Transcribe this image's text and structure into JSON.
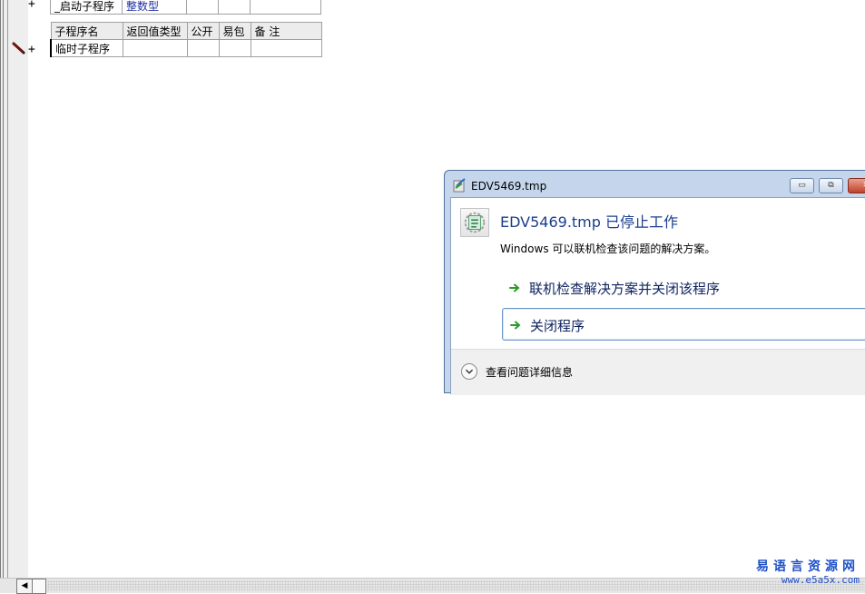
{
  "code_table_1": {
    "row": [
      "_启动子程序",
      "整数型",
      "",
      "",
      ""
    ]
  },
  "code_table_2": {
    "headers": [
      "子程序名",
      "返回值类型",
      "公开",
      "易包",
      "备 注"
    ],
    "row": [
      "临时子程序",
      "",
      "",
      "",
      ""
    ]
  },
  "gutter": {
    "plus": "+"
  },
  "dialog": {
    "title": "EDV5469.tmp",
    "heading": "EDV5469.tmp 已停止工作",
    "subtext": "Windows 可以联机检查该问题的解决方案。",
    "option_check_online": "联机检查解决方案并关闭该程序",
    "option_close": "关闭程序",
    "details_label": "查看问题详细信息",
    "minimize_label": "▭",
    "restore_label": "⧉",
    "close_label": "✕"
  },
  "scrollbar": {
    "left_arrow": "◀"
  },
  "watermark": {
    "line1": "易语言资源网",
    "line2": "www.e5a5x.com"
  },
  "colors": {
    "accent_green": "#2a9a2a",
    "heading_blue": "#1a3e8f",
    "watermark_blue": "#1e4fc8"
  }
}
